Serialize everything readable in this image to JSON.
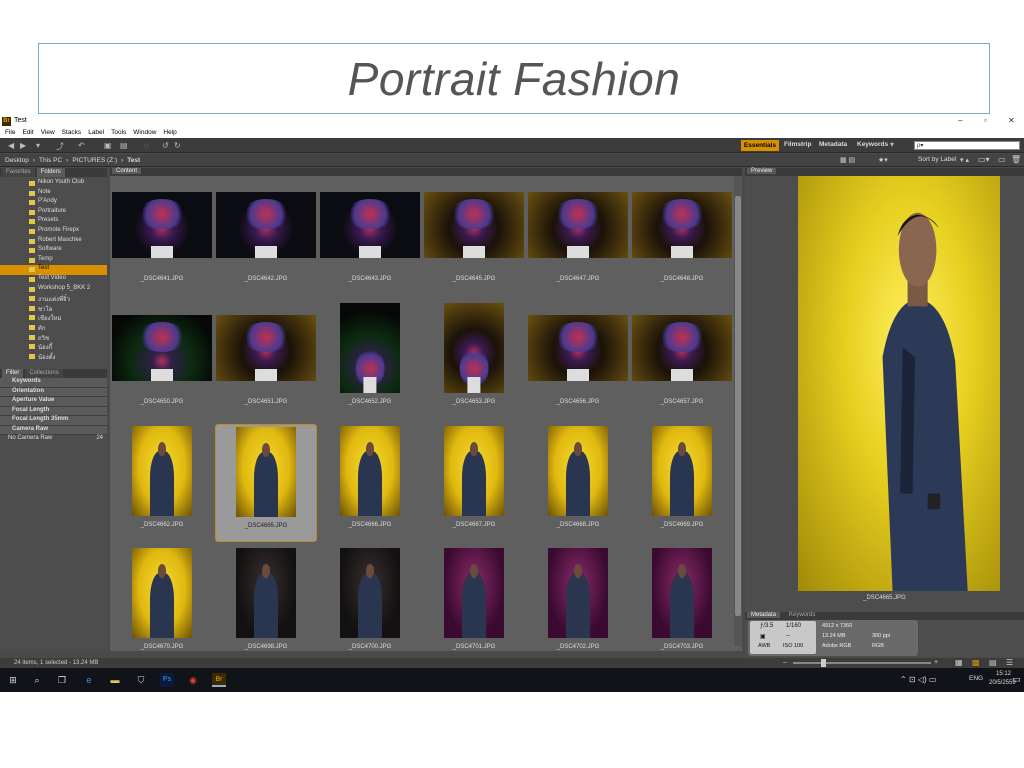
{
  "slide": {
    "title": "Portrait Fashion"
  },
  "window": {
    "title": "Test",
    "app_icon": "Br",
    "controls": [
      "–",
      "▫",
      "✕"
    ]
  },
  "menu": [
    "File",
    "Edit",
    "View",
    "Stacks",
    "Label",
    "Tools",
    "Window",
    "Help"
  ],
  "workspaces": {
    "essentials": "Essentials",
    "filmstrip": "Filmstrip",
    "metadata": "Metadata",
    "keywords": "Keywords"
  },
  "search": {
    "placeholder": "ρ▾"
  },
  "path": [
    "Desktop",
    "This PC",
    "PICTURES (Z:)",
    "Test"
  ],
  "view_controls": {
    "sort": "Sort by Label"
  },
  "left_panel": {
    "tabs": [
      "Favorites",
      "Folders"
    ],
    "folders": [
      "Nikon Youth Club",
      "Note",
      "P'Andy",
      "Portraiture",
      "Presets",
      "Promote Firepx",
      "Robert Maschke",
      "Software",
      "Temp",
      "Test",
      "Test Video",
      "Workshop 5_BKK 2",
      "งานแต่งพี่จิ๋ว",
      "ชาโล",
      "เชียงใหม่",
      "ตัก",
      "ถวิช",
      "น้องกี้",
      "น้องตั้ง"
    ],
    "selected_folder": "Test",
    "filter_tabs": [
      "Filter",
      "Collections"
    ],
    "filters": [
      "Keywords",
      "Orientation",
      "Aperture Value",
      "Focal Length",
      "Focal Length 35mm",
      "Camera Raw"
    ],
    "filter_value": {
      "label": "No Camera Raw",
      "count": "24"
    }
  },
  "content": {
    "tab": "Content",
    "items": [
      {
        "name": "_DSC4641.JPG",
        "kind": "dark"
      },
      {
        "name": "_DSC4642.JPG",
        "kind": "dark"
      },
      {
        "name": "_DSC4643.JPG",
        "kind": "dark"
      },
      {
        "name": "_DSC4645.JPG",
        "kind": "warm"
      },
      {
        "name": "_DSC4647.JPG",
        "kind": "warm"
      },
      {
        "name": "_DSC4648.JPG",
        "kind": "warm"
      },
      {
        "name": "_DSC4650.JPG",
        "kind": "green"
      },
      {
        "name": "_DSC4651.JPG",
        "kind": "warm"
      },
      {
        "name": "_DSC4652.JPG",
        "kind": "green",
        "portrait": true
      },
      {
        "name": "_DSC4653.JPG",
        "kind": "warm",
        "portrait": true
      },
      {
        "name": "_DSC4656.JPG",
        "kind": "warm"
      },
      {
        "name": "_DSC4657.JPG",
        "kind": "warm"
      },
      {
        "name": "_DSC4662.JPG",
        "kind": "yellow"
      },
      {
        "name": "_DSC4665.JPG",
        "kind": "yellow",
        "selected": true
      },
      {
        "name": "_DSC4666.JPG",
        "kind": "yellow"
      },
      {
        "name": "_DSC4667.JPG",
        "kind": "yellow"
      },
      {
        "name": "_DSC4668.JPG",
        "kind": "yellow"
      },
      {
        "name": "_DSC4669.JPG",
        "kind": "yellow"
      },
      {
        "name": "_DSC4670.JPG",
        "kind": "yellow"
      },
      {
        "name": "_DSC4698.JPG",
        "kind": "darkp"
      },
      {
        "name": "_DSC4700.JPG",
        "kind": "darkp"
      },
      {
        "name": "_DSC4701.JPG",
        "kind": "magenta"
      },
      {
        "name": "_DSC4702.JPG",
        "kind": "magenta"
      },
      {
        "name": "_DSC4703.JPG",
        "kind": "magenta"
      }
    ]
  },
  "preview": {
    "tab": "Preview",
    "caption": "_DSC4665.JPG"
  },
  "metadata": {
    "tabs": [
      "Metadata",
      "Keywords"
    ],
    "aperture": "ƒ/3.5",
    "shutter": "1/160",
    "iso": "ISO 100",
    "metering": "--",
    "awb": "AWB",
    "dimensions": "4912 x 7360",
    "size": "13.24 MB",
    "ppi": "300 ppi",
    "profile": "Adobe RGB",
    "mode": "RGB"
  },
  "status": {
    "text": "24 items, 1 selected - 13.24 MB"
  },
  "taskbar": {
    "lang": "ENG",
    "time": "15:12",
    "date": "20/5/2559"
  }
}
